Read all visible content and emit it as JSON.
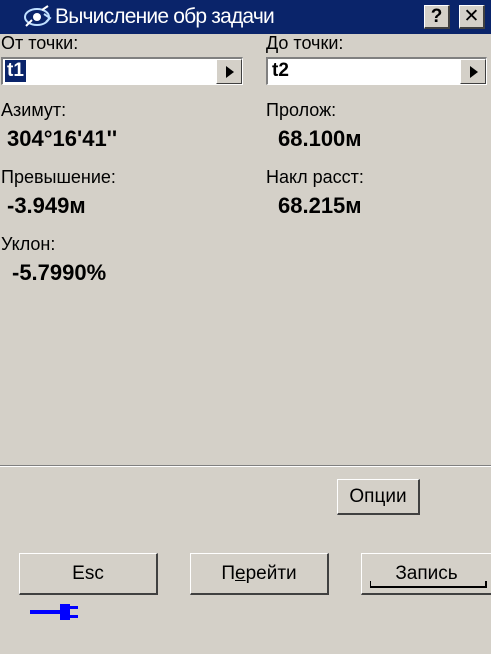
{
  "window": {
    "title": "Вычисление обр задачи",
    "help_label": "?",
    "close_label": "✕"
  },
  "from": {
    "label": "От точки:",
    "value": "t1"
  },
  "to": {
    "label": "До точки:",
    "value": "t2"
  },
  "results": {
    "azimuth": {
      "label": "Азимут:",
      "value": "304°16'41''"
    },
    "horizontal_distance": {
      "label": "Пролож:",
      "value": "68.100м"
    },
    "height_difference": {
      "label": "Превышение:",
      "value": "-3.949м"
    },
    "slope_distance": {
      "label": "Накл расст:",
      "value": "68.215м"
    },
    "grade": {
      "label": "Уклон:",
      "value": "-5.7990%"
    }
  },
  "buttons": {
    "options": "Опции",
    "esc": "Esc",
    "goto_prefix": "П",
    "goto_mnemonic": "е",
    "goto_suffix": "рейти",
    "record": "Запись"
  },
  "status": {
    "icon": "power-plug-icon",
    "color": "#0000ff"
  }
}
